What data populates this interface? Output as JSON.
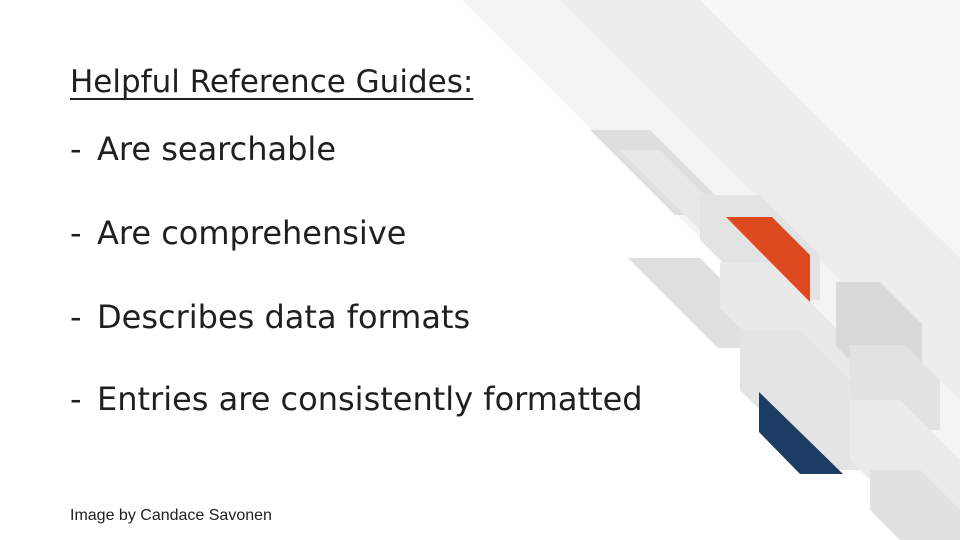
{
  "slide": {
    "title": "Helpful Reference Guides:",
    "bullets": [
      {
        "dash": "-",
        "text": "Are searchable"
      },
      {
        "dash": "-",
        "text": "Are comprehensive"
      },
      {
        "dash": "-",
        "text": "Describes data formats"
      },
      {
        "dash": "-",
        "text": "Entries are consistently formatted"
      }
    ],
    "credit": "Image by Candace Savonen"
  },
  "colors": {
    "accent_orange": "#de4a1f",
    "accent_navy": "#1c3d63",
    "decor_gray": "#e6e6e6",
    "text": "#1f1f1f"
  }
}
